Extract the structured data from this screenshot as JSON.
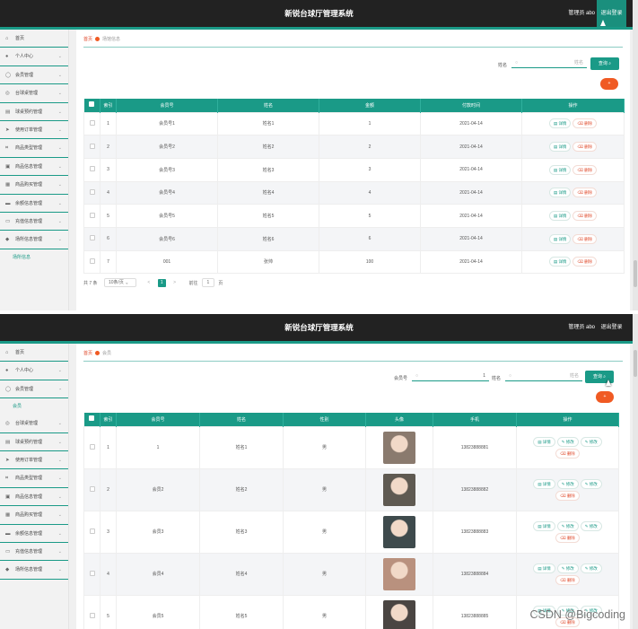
{
  "app": {
    "title": "新锐台球厅管理系统",
    "admin_label": "管理员 abo",
    "logout_label": "退出登录"
  },
  "colors": {
    "primary": "#1a9a87",
    "header": "#222222",
    "danger": "#f05a23"
  },
  "panel1": {
    "breadcrumb": {
      "home": "首页",
      "current": "场馆信息"
    },
    "sidebar": [
      {
        "label": "首页",
        "icon": "home-icon"
      },
      {
        "label": "个人中心",
        "icon": "user-icon"
      },
      {
        "label": "会员管理",
        "icon": "member-icon"
      },
      {
        "label": "台球桌管理",
        "icon": "table-icon"
      },
      {
        "label": "球桌预约管理",
        "icon": "calendar-icon"
      },
      {
        "label": "使用订单管理",
        "icon": "send-icon"
      },
      {
        "label": "商品类型管理",
        "icon": "type-icon"
      },
      {
        "label": "商品信息管理",
        "icon": "goods-icon"
      },
      {
        "label": "商品购买管理",
        "icon": "cart-icon"
      },
      {
        "label": "余额信息管理",
        "icon": "wallet-icon"
      },
      {
        "label": "充值信息管理",
        "icon": "recharge-icon"
      },
      {
        "label": "场所信息管理",
        "icon": "venue-icon"
      }
    ],
    "sidebar_sub": "场所信息",
    "search": {
      "label": "姓名",
      "placeholder": "姓名",
      "button": "查询"
    },
    "add_label": "+",
    "columns": [
      "索引",
      "会员号",
      "姓名",
      "金额",
      "付款时间",
      "操作"
    ],
    "rows": [
      {
        "idx": "1",
        "no": "会员号1",
        "name": "姓名1",
        "amount": "1",
        "time": "2021-04-14"
      },
      {
        "idx": "2",
        "no": "会员号2",
        "name": "姓名2",
        "amount": "2",
        "time": "2021-04-14"
      },
      {
        "idx": "3",
        "no": "会员号3",
        "name": "姓名3",
        "amount": "3",
        "time": "2021-04-14"
      },
      {
        "idx": "4",
        "no": "会员号4",
        "name": "姓名4",
        "amount": "4",
        "time": "2021-04-14"
      },
      {
        "idx": "5",
        "no": "会员号5",
        "name": "姓名5",
        "amount": "5",
        "time": "2021-04-14"
      },
      {
        "idx": "6",
        "no": "会员号6",
        "name": "姓名6",
        "amount": "6",
        "time": "2021-04-14"
      },
      {
        "idx": "7",
        "no": "001",
        "name": "张帅",
        "amount": "100",
        "time": "2021-04-14"
      }
    ],
    "actions": {
      "detail": "详情",
      "delete": "删除"
    },
    "pager": {
      "total": "共 7 条",
      "size": "10条/页",
      "prev": "<",
      "page": "1",
      "next": ">",
      "goto": "前往",
      "goto_val": "1",
      "unit": "页"
    }
  },
  "panel2": {
    "breadcrumb": {
      "home": "首页",
      "current": "会员"
    },
    "sidebar": [
      {
        "label": "首页",
        "icon": "home-icon"
      },
      {
        "label": "个人中心",
        "icon": "user-icon"
      },
      {
        "label": "会员管理",
        "icon": "member-icon",
        "open": true
      },
      {
        "label": "台球桌管理",
        "icon": "table-icon"
      },
      {
        "label": "球桌预约管理",
        "icon": "calendar-icon"
      },
      {
        "label": "使用订单管理",
        "icon": "send-icon"
      },
      {
        "label": "商品类型管理",
        "icon": "type-icon"
      },
      {
        "label": "商品信息管理",
        "icon": "goods-icon"
      },
      {
        "label": "商品购买管理",
        "icon": "cart-icon"
      },
      {
        "label": "余额信息管理",
        "icon": "wallet-icon"
      },
      {
        "label": "充值信息管理",
        "icon": "recharge-icon"
      },
      {
        "label": "场所信息管理",
        "icon": "venue-icon"
      }
    ],
    "sidebar_sub": "会员",
    "search": {
      "label1": "会员号",
      "value1": "1",
      "label2": "姓名",
      "placeholder2": "姓名",
      "button": "查询"
    },
    "add_label": "+",
    "columns": [
      "索引",
      "会员号",
      "姓名",
      "性别",
      "头像",
      "手机",
      "操作"
    ],
    "rows": [
      {
        "idx": "1",
        "no": "1",
        "name": "姓名1",
        "sex": "男",
        "phone": "13823888881",
        "avatar_color": "#8a7a6e"
      },
      {
        "idx": "2",
        "no": "会员2",
        "name": "姓名2",
        "sex": "男",
        "phone": "13823888882",
        "avatar_color": "#5f5a52"
      },
      {
        "idx": "3",
        "no": "会员3",
        "name": "姓名3",
        "sex": "男",
        "phone": "13823888883",
        "avatar_color": "#3e4a4c"
      },
      {
        "idx": "4",
        "no": "会员4",
        "name": "姓名4",
        "sex": "男",
        "phone": "13823888884",
        "avatar_color": "#b9917e"
      },
      {
        "idx": "5",
        "no": "会员5",
        "name": "姓名5",
        "sex": "男",
        "phone": "13823888885",
        "avatar_color": "#4a4542"
      }
    ],
    "actions": {
      "detail": "详情",
      "edit": "修改",
      "change": "修改",
      "delete": "删除"
    }
  },
  "watermark": "CSDN @Bigcoding"
}
